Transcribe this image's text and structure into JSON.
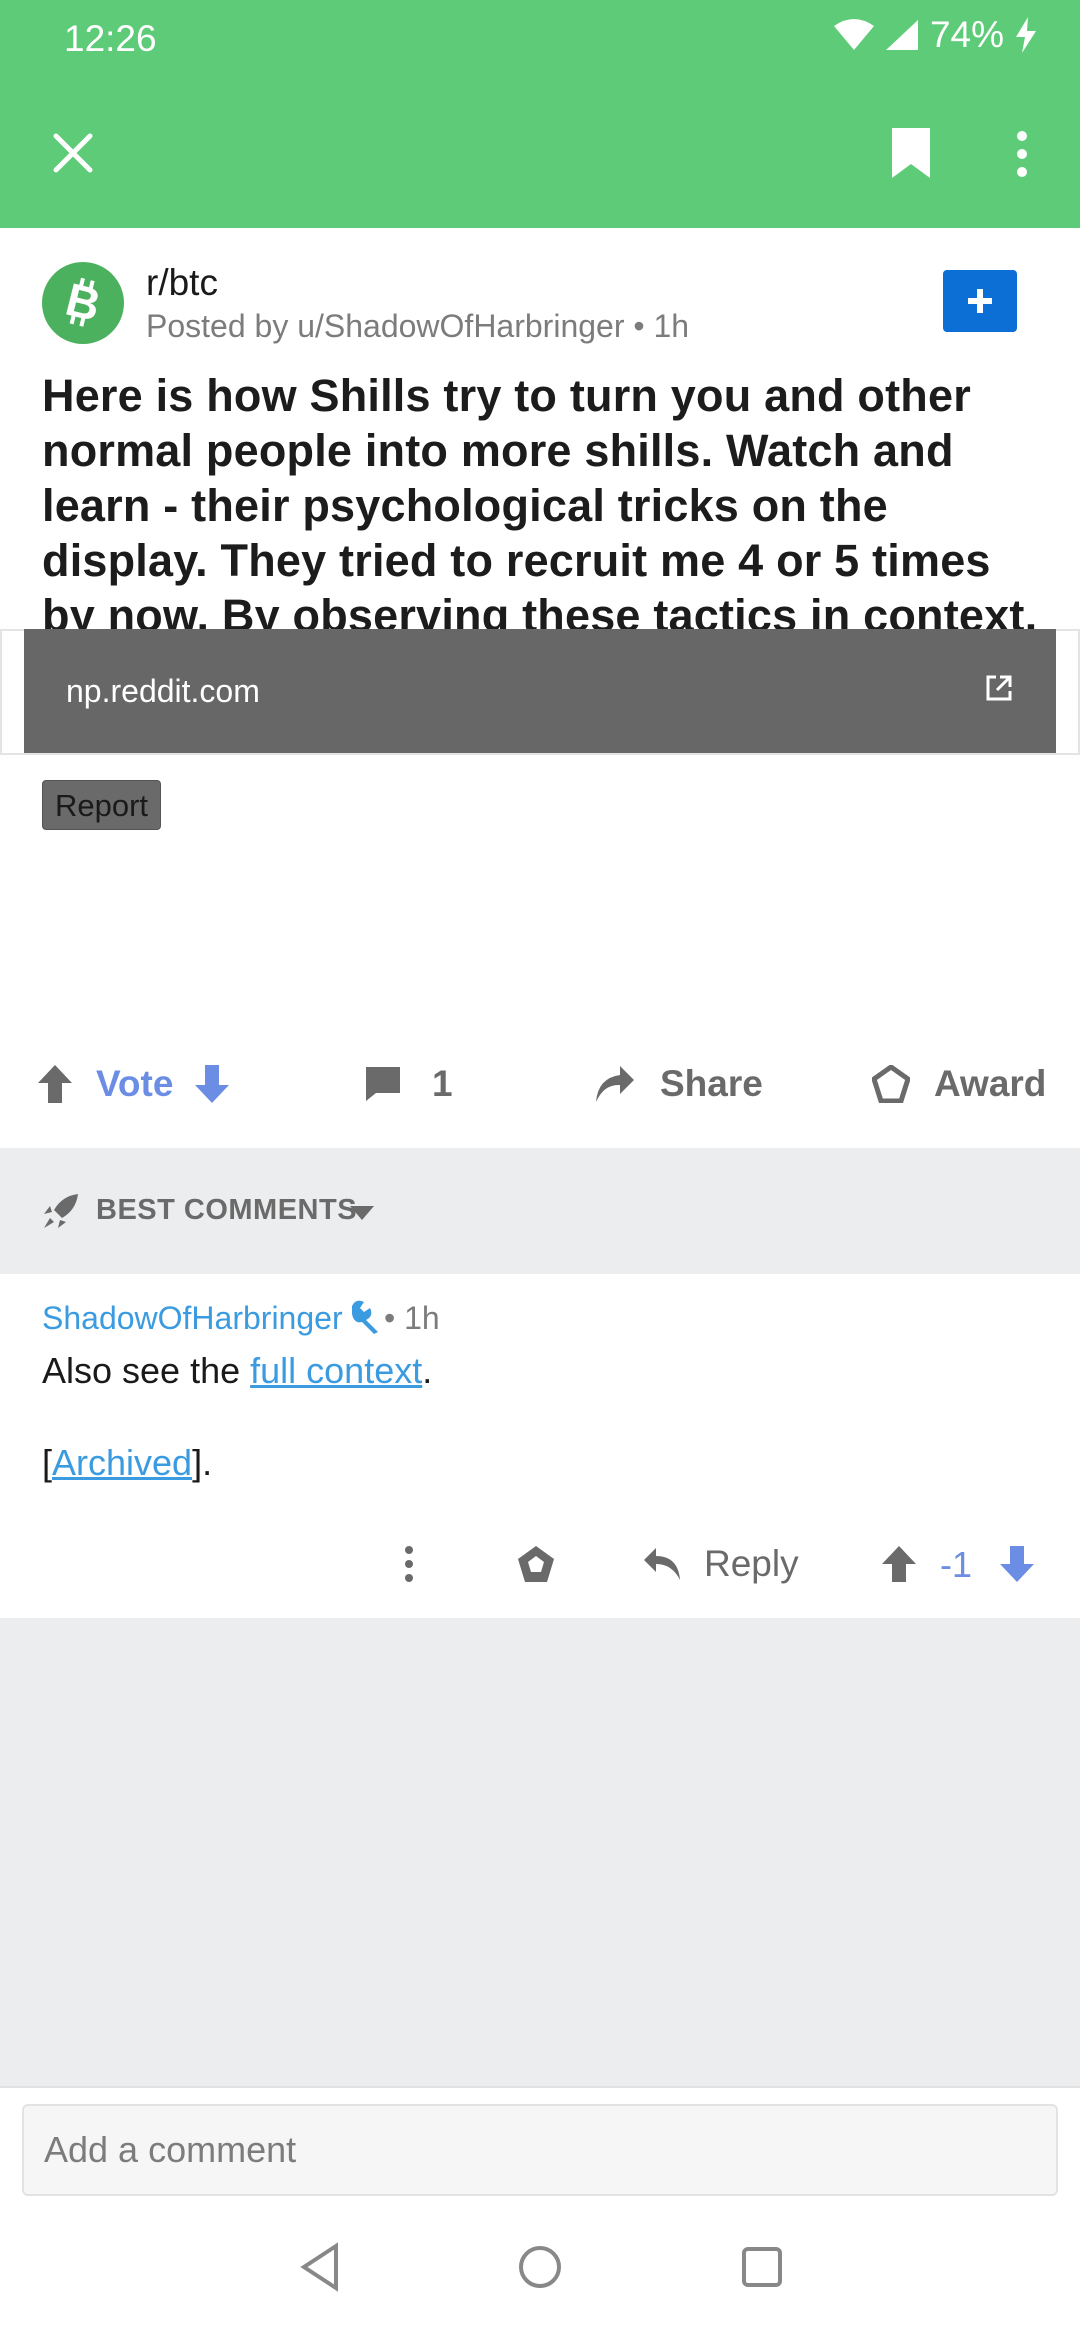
{
  "status_bar": {
    "time": "12:26",
    "battery": "74%"
  },
  "toolbar": {
    "close": "close",
    "bookmark": "bookmark",
    "more": "more"
  },
  "post": {
    "subreddit": "r/btc",
    "posted_by": "Posted by u/ShadowOfHarbringer • 1h",
    "title": "Here is how Shills try to turn you and other normal people into more shills. Watch and learn - their psychological tricks on the display. They tried to recruit me 4 or 5 times by now. By observing these tactics in context, you can vaccinate yourself, just as I have vaccinated myself.",
    "report_label": "Report",
    "link_domain": "np.reddit.com"
  },
  "actions": {
    "vote": "Vote",
    "comments_count": "1",
    "share": "Share",
    "award": "Award"
  },
  "comments_header": {
    "sort_label": "BEST COMMENTS"
  },
  "comment": {
    "author": "ShadowOfHarbringer",
    "time": "• 1h",
    "line1_prefix": "Also see the ",
    "line1_link": "full context",
    "line1_suffix": ".",
    "line2_prefix": "[",
    "line2_link": "Archived",
    "line2_suffix": "].",
    "reply_label": "Reply",
    "score": "-1"
  },
  "composer": {
    "placeholder": "Add a comment"
  },
  "colors": {
    "brand_green": "#5ecb78",
    "vote_blue": "#6b8de3",
    "link_blue": "#3b9be0",
    "join_blue": "#0b6fd6"
  }
}
